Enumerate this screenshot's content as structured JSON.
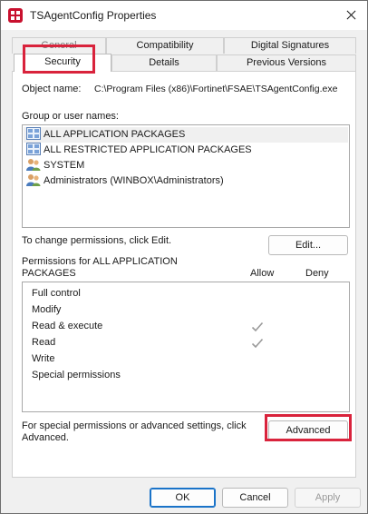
{
  "window": {
    "title": "TSAgentConfig Properties"
  },
  "tabs": [
    {
      "label": "General"
    },
    {
      "label": "Compatibility"
    },
    {
      "label": "Digital Signatures"
    },
    {
      "label": "Security"
    },
    {
      "label": "Details"
    },
    {
      "label": "Previous Versions"
    }
  ],
  "object": {
    "label": "Object name:",
    "value": "C:\\Program Files (x86)\\Fortinet\\FSAE\\TSAgentConfig.exe"
  },
  "groups": {
    "label": "Group or user names:",
    "items": [
      {
        "name": "ALL APPLICATION PACKAGES",
        "icon": "package-icon"
      },
      {
        "name": "ALL RESTRICTED APPLICATION PACKAGES",
        "icon": "package-icon"
      },
      {
        "name": "SYSTEM",
        "icon": "users-icon"
      },
      {
        "name": "Administrators (WINBOX\\Administrators)",
        "icon": "users-icon"
      }
    ]
  },
  "change_hint": "To change permissions, click Edit.",
  "edit_button": "Edit...",
  "permissions": {
    "label_line1": "Permissions for ALL APPLICATION",
    "label_line2": "PACKAGES",
    "allow_header": "Allow",
    "deny_header": "Deny",
    "rows": [
      {
        "name": "Full control",
        "allow": false,
        "deny": false
      },
      {
        "name": "Modify",
        "allow": false,
        "deny": false
      },
      {
        "name": "Read & execute",
        "allow": true,
        "deny": false
      },
      {
        "name": "Read",
        "allow": true,
        "deny": false
      },
      {
        "name": "Write",
        "allow": false,
        "deny": false
      },
      {
        "name": "Special permissions",
        "allow": false,
        "deny": false
      }
    ]
  },
  "advanced_hint_line1": "For special permissions or advanced settings, click",
  "advanced_hint_line2": "Advanced.",
  "advanced_button": "Advanced",
  "footer": {
    "ok": "OK",
    "cancel": "Cancel",
    "apply": "Apply"
  },
  "colors": {
    "highlight": "#d9233c",
    "accent": "#1a73c8",
    "app_icon": "#c8102e"
  }
}
